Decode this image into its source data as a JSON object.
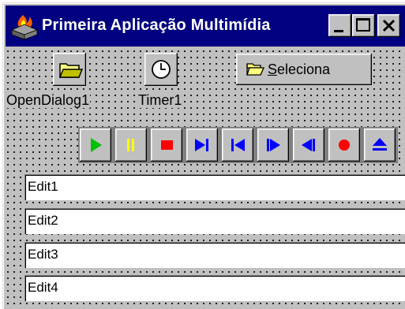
{
  "window": {
    "title": "Primeira Aplicação Multimídia",
    "caption_buttons": [
      "minimize-icon",
      "maximize-icon",
      "close-icon"
    ]
  },
  "components": [
    {
      "label": "OpenDialog1",
      "icon": "folder-icon"
    },
    {
      "label": "Timer1",
      "icon": "clock-icon"
    }
  ],
  "select_button": {
    "icon": "folder-open-icon",
    "accelerator": "S",
    "label_rest": "eleciona"
  },
  "media_player": {
    "buttons": [
      {
        "name": "play",
        "icon": "play-icon",
        "color": "#00c000"
      },
      {
        "name": "pause",
        "icon": "pause-icon",
        "color": "#ffff00"
      },
      {
        "name": "stop",
        "icon": "stop-icon",
        "color": "#ff0000"
      },
      {
        "name": "next",
        "icon": "next-icon",
        "color": "#0000ff"
      },
      {
        "name": "prev",
        "icon": "prev-icon",
        "color": "#0000ff"
      },
      {
        "name": "step",
        "icon": "step-icon",
        "color": "#0000ff"
      },
      {
        "name": "back",
        "icon": "back-icon",
        "color": "#0000ff"
      },
      {
        "name": "record",
        "icon": "record-icon",
        "color": "#ff0000"
      },
      {
        "name": "eject",
        "icon": "eject-icon",
        "color": "#0000ff"
      }
    ]
  },
  "edits": [
    {
      "value": "Edit1"
    },
    {
      "value": "Edit2"
    },
    {
      "value": "Edit3"
    },
    {
      "value": "Edit4"
    }
  ],
  "colors": {
    "titlebar": "#000080",
    "face": "#c0c0c0"
  }
}
